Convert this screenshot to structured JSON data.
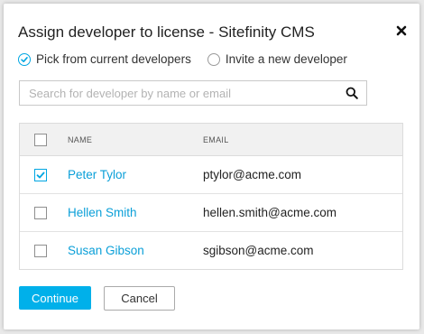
{
  "dialog": {
    "title": "Assign developer to license - Sitefinity CMS",
    "close_icon": "close-icon"
  },
  "mode": {
    "options": [
      {
        "label": "Pick from current developers",
        "selected": true
      },
      {
        "label": "Invite a new developer",
        "selected": false
      }
    ]
  },
  "search": {
    "placeholder": "Search for developer by name or email",
    "value": "",
    "icon": "search-icon"
  },
  "table": {
    "columns": {
      "name": "NAME",
      "email": "EMAIL"
    },
    "rows": [
      {
        "name": "Peter Tylor",
        "email": "ptylor@acme.com",
        "checked": true
      },
      {
        "name": "Hellen Smith",
        "email": "hellen.smith@acme.com",
        "checked": false
      },
      {
        "name": "Susan Gibson",
        "email": "sgibson@acme.com",
        "checked": false
      }
    ]
  },
  "actions": {
    "continue_label": "Continue",
    "cancel_label": "Cancel"
  },
  "colors": {
    "accent": "#00a6e2",
    "link": "#0a9fd8",
    "button_primary": "#00b0ea"
  }
}
